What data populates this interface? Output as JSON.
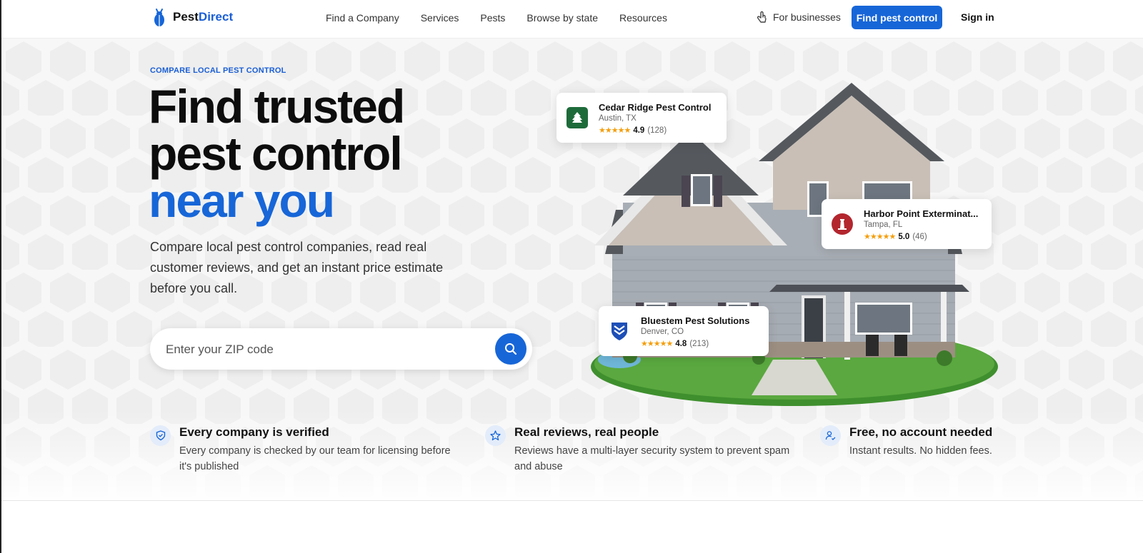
{
  "header": {
    "logo_part1": "Pest",
    "logo_part2": "Direct",
    "nav": [
      "Find a Company",
      "Services",
      "Pests",
      "Browse by state",
      "Resources"
    ],
    "for_businesses": "For businesses",
    "cta": "Find pest control",
    "sign_in": "Sign in"
  },
  "hero": {
    "eyebrow": "COMPARE LOCAL PEST CONTROL",
    "headline_line1": "Find trusted",
    "headline_line2": "pest control",
    "headline_line3": "near you",
    "subtitle": "Compare local pest control companies, read real customer reviews, and get an instant price estimate before you call.",
    "zip_placeholder": "Enter your ZIP code"
  },
  "cards": [
    {
      "name": "Cedar Ridge Pest Control",
      "location": "Austin, TX",
      "stars": "★★★★★",
      "score": "4.9",
      "count": "(128)",
      "icon": "pine-tree-icon",
      "color": "#1e6b3a"
    },
    {
      "name": "Harbor Point Exterminat...",
      "location": "Tampa, FL",
      "stars": "★★★★★",
      "score": "5.0",
      "count": "(46)",
      "icon": "lighthouse-icon",
      "color": "#b3262e"
    },
    {
      "name": "Bluestem Pest Solutions",
      "location": "Denver, CO",
      "stars": "★★★★★",
      "score": "4.8",
      "count": "(213)",
      "icon": "shield-chevron-icon",
      "color": "#1d4fb8"
    }
  ],
  "features": [
    {
      "title": "Every company is verified",
      "desc": "Every company is checked by our team for licensing before it's published",
      "icon": "shield-check-icon"
    },
    {
      "title": "Real reviews, real people",
      "desc": "Reviews have a multi-layer security system to prevent spam and abuse",
      "icon": "star-icon"
    },
    {
      "title": "Free, no account needed",
      "desc": "Instant results. No hidden fees.",
      "icon": "user-check-icon"
    }
  ],
  "colors": {
    "accent": "#1766d8",
    "star": "#f59e0b"
  }
}
